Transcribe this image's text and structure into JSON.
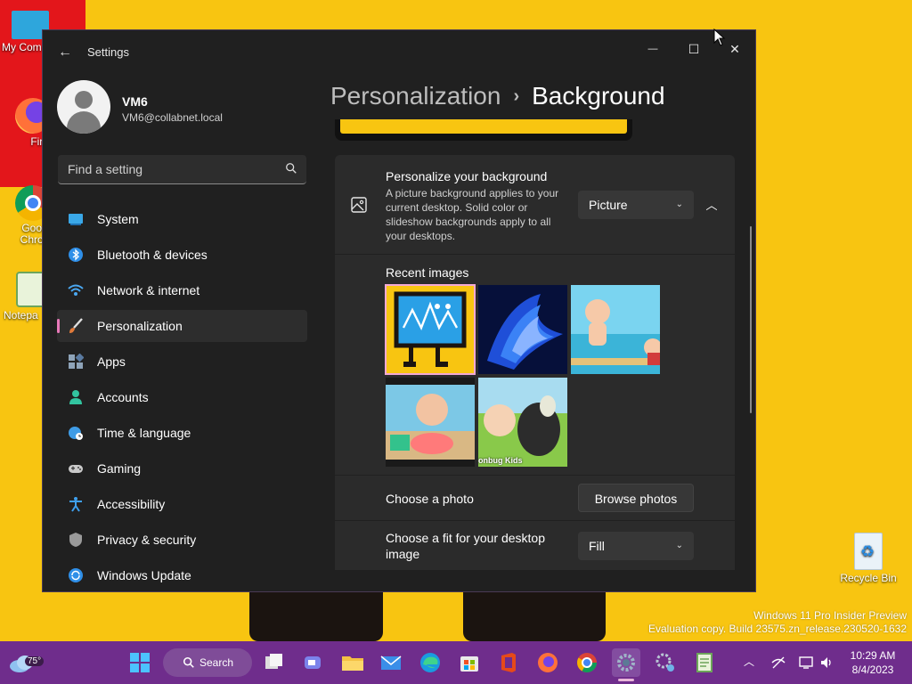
{
  "desktop": {
    "icons": [
      {
        "label": "My Com",
        "name": "my-computer"
      },
      {
        "label": "Firefo",
        "name": "firefox"
      },
      {
        "label": "Goog Chron",
        "name": "google-chrome"
      },
      {
        "label": "Notepa",
        "name": "notepad"
      }
    ],
    "recycle_bin": "Recycle Bin",
    "watermark_line1": "Windows 11 Pro Insider Preview",
    "watermark_line2": "Evaluation copy. Build 23575.zn_release.230520-1632"
  },
  "window": {
    "title": "Settings",
    "back_glyph": "←",
    "minimize_glyph": "—",
    "maximize_glyph": "☐",
    "close_glyph": "✕"
  },
  "profile": {
    "name": "VM6",
    "email": "VM6@collabnet.local"
  },
  "search": {
    "placeholder": "Find a setting"
  },
  "sidebar": {
    "items": [
      {
        "label": "System",
        "icon": "system-icon"
      },
      {
        "label": "Bluetooth & devices",
        "icon": "bluetooth-icon"
      },
      {
        "label": "Network & internet",
        "icon": "wifi-icon"
      },
      {
        "label": "Personalization",
        "icon": "brush-icon",
        "active": true
      },
      {
        "label": "Apps",
        "icon": "apps-icon"
      },
      {
        "label": "Accounts",
        "icon": "person-icon"
      },
      {
        "label": "Time & language",
        "icon": "globe-clock-icon"
      },
      {
        "label": "Gaming",
        "icon": "gamepad-icon"
      },
      {
        "label": "Accessibility",
        "icon": "accessibility-icon"
      },
      {
        "label": "Privacy & security",
        "icon": "shield-icon"
      },
      {
        "label": "Windows Update",
        "icon": "update-icon"
      }
    ]
  },
  "breadcrumb": {
    "parent": "Personalization",
    "separator": "›",
    "current": "Background"
  },
  "background_card": {
    "title": "Personalize your background",
    "description": "A picture background applies to your current desktop. Solid color or slideshow backgrounds apply to all your desktops.",
    "dropdown_value": "Picture",
    "chevron": "⌄",
    "collapse_glyph": "︿"
  },
  "recent_images": {
    "label": "Recent images",
    "images": [
      {
        "name": "thumb-yellow-character",
        "selected": true
      },
      {
        "name": "thumb-windows-bloom"
      },
      {
        "name": "thumb-cartoon-baby-beach"
      },
      {
        "name": "thumb-cartoon-baby-pool"
      },
      {
        "name": "thumb-cartoon-sheep"
      }
    ],
    "sheep_caption": "onbug Kids"
  },
  "choose_photo": {
    "label": "Choose a photo",
    "button": "Browse photos"
  },
  "choose_fit": {
    "label": "Choose a fit for your desktop image",
    "dropdown_value": "Fill"
  },
  "taskbar": {
    "temperature": "75°",
    "search_label": "Search",
    "time": "10:29 AM",
    "date": "8/4/2023"
  },
  "colors": {
    "desktop": "#f8c511",
    "taskbar": "#6f2d8c",
    "accent": "#e879b9",
    "window_bg": "#202020",
    "card_bg": "#2b2b2b"
  }
}
